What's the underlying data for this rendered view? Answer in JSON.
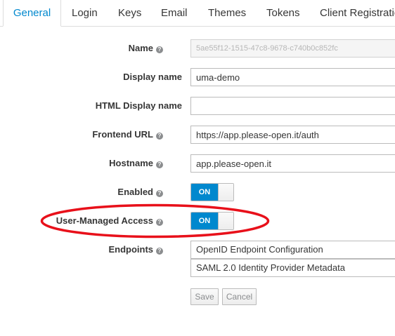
{
  "tabs": [
    {
      "label": "General",
      "active": true
    },
    {
      "label": "Login"
    },
    {
      "label": "Keys"
    },
    {
      "label": "Email"
    },
    {
      "label": "Themes"
    },
    {
      "label": "Tokens"
    },
    {
      "label": "Client Registration"
    }
  ],
  "form": {
    "name": {
      "label": "Name",
      "value": "5ae55f12-1515-47c8-9678-c740b0c852fc"
    },
    "display_name": {
      "label": "Display name",
      "value": "uma-demo"
    },
    "html_display_name": {
      "label": "HTML Display name",
      "value": ""
    },
    "frontend_url": {
      "label": "Frontend URL",
      "value": "https://app.please-open.it/auth"
    },
    "hostname": {
      "label": "Hostname",
      "value": "app.please-open.it"
    },
    "enabled": {
      "label": "Enabled",
      "state": "ON"
    },
    "uma": {
      "label": "User-Managed Access",
      "state": "ON"
    },
    "endpoints": {
      "label": "Endpoints",
      "items": [
        "OpenID Endpoint Configuration",
        "SAML 2.0 Identity Provider Metadata"
      ]
    }
  },
  "actions": {
    "save": "Save",
    "cancel": "Cancel"
  },
  "colors": {
    "accent": "#0088ce",
    "highlight": "#e8101a"
  }
}
